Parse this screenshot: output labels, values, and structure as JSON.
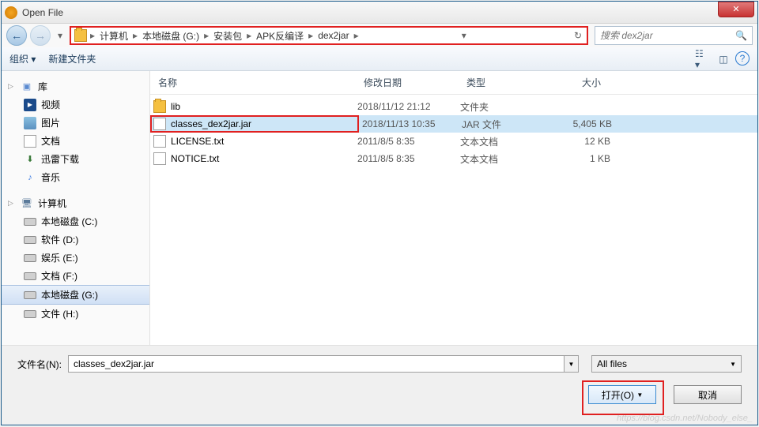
{
  "title": "Open File",
  "nav": {
    "back": "←",
    "fwd": "→",
    "refresh_dropdown": "▾",
    "refresh": "↻"
  },
  "breadcrumb": [
    "计算机",
    "本地磁盘 (G:)",
    "安装包",
    "APK反编译",
    "dex2jar"
  ],
  "search": {
    "placeholder": "搜索 dex2jar"
  },
  "toolbar": {
    "organize": "组织 ▾",
    "newfolder": "新建文件夹"
  },
  "sidebar": {
    "library": {
      "label": "库",
      "items": [
        "视频",
        "图片",
        "文档",
        "迅雷下载",
        "音乐"
      ]
    },
    "computer": {
      "label": "计算机",
      "items": [
        "本地磁盘 (C:)",
        "软件 (D:)",
        "娱乐 (E:)",
        "文档 (F:)",
        "本地磁盘 (G:)",
        "文件 (H:)"
      ],
      "selected_index": 4
    }
  },
  "columns": {
    "name": "名称",
    "date": "修改日期",
    "type": "类型",
    "size": "大小"
  },
  "files": [
    {
      "name": "lib",
      "date": "2018/11/12 21:12",
      "type": "文件夹",
      "size": "",
      "icon": "folder"
    },
    {
      "name": "classes_dex2jar.jar",
      "date": "2018/11/13 10:35",
      "type": "JAR 文件",
      "size": "5,405 KB",
      "icon": "file",
      "selected": true,
      "highlighted": true
    },
    {
      "name": "LICENSE.txt",
      "date": "2011/8/5 8:35",
      "type": "文本文档",
      "size": "12 KB",
      "icon": "file"
    },
    {
      "name": "NOTICE.txt",
      "date": "2011/8/5 8:35",
      "type": "文本文档",
      "size": "1 KB",
      "icon": "file"
    }
  ],
  "bottom": {
    "filename_label": "文件名(N):",
    "filename_value": "classes_dex2jar.jar",
    "filter": "All files",
    "open": "打开(O)",
    "cancel": "取消"
  },
  "watermark": "https://blog.csdn.net/Nobody_else_"
}
